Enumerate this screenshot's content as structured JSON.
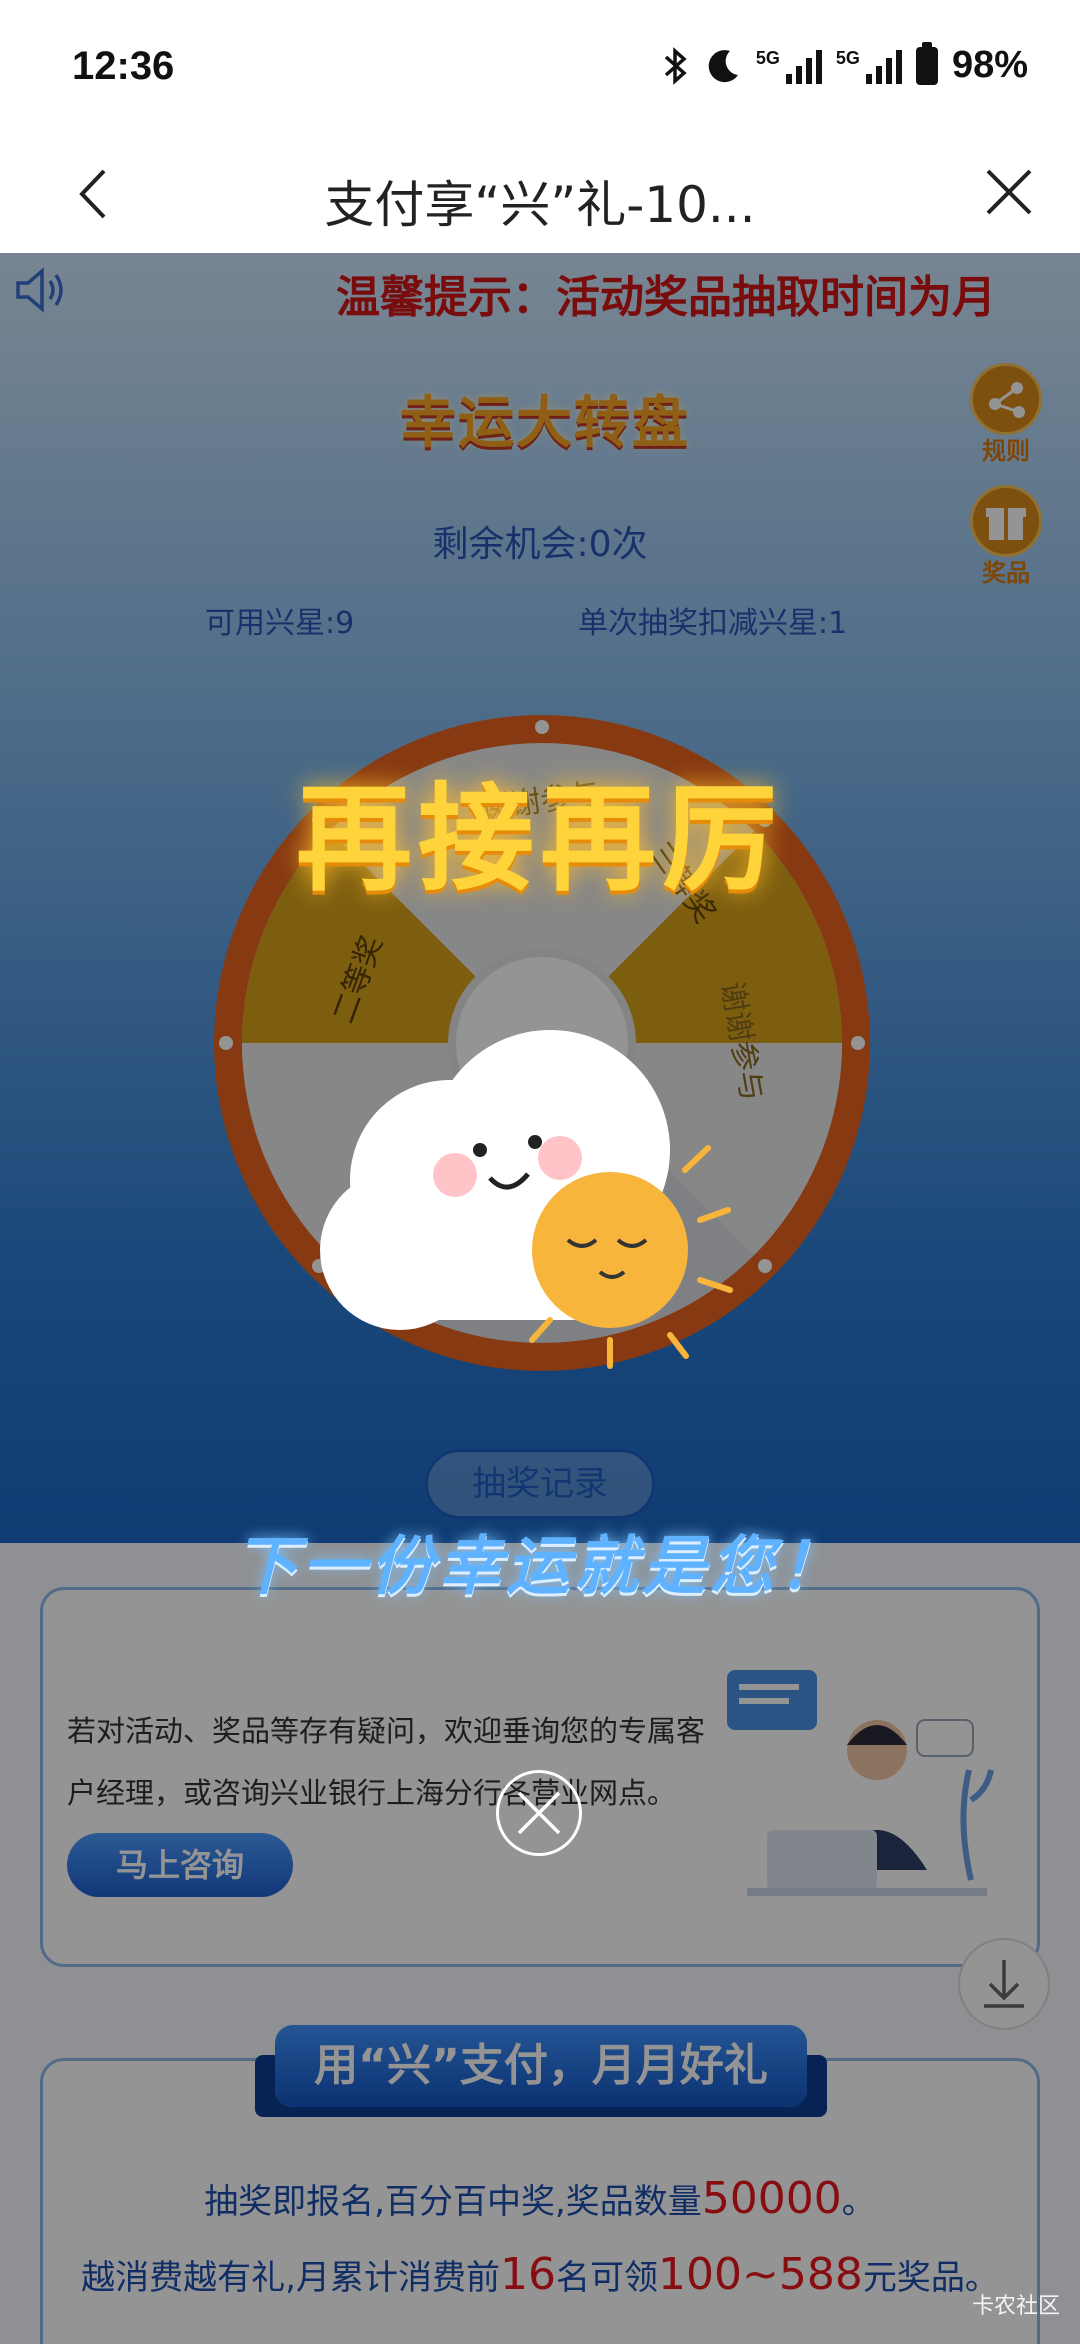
{
  "status_bar": {
    "time": "12:36",
    "battery": "98%",
    "net1": "5G",
    "net2": "5G"
  },
  "nav": {
    "title": "支付享“兴”礼-10..."
  },
  "notice": {
    "text": "温馨提示：活动奖品抽取时间为月"
  },
  "wheel_section": {
    "title": "幸运大转盘",
    "rules_label": "规则",
    "prizes_label": "奖品",
    "remaining": "剩余机会:0次",
    "stars": "可用兴星:9",
    "deduct": "单次抽奖扣减兴星:1",
    "segments": [
      "谢谢参与",
      "三等奖",
      "谢谢参与",
      "二等奖"
    ],
    "record_button": "抽奖记录"
  },
  "consult_card": {
    "text": "若对活动、奖品等存有疑问，欢迎垂询您的专属客户经理，或咨询兴业银行上海分行各营业网点。",
    "button": "马上咨询"
  },
  "promo_card": {
    "ribbon": "用“兴”支付，月月好礼",
    "line1_a": "抽奖即报名,百分百中奖,奖品数量",
    "line1_num": "50000",
    "line1_b": "。",
    "line2_a": "越消费越有礼,月累计消费前",
    "line2_num": "16",
    "line2_b": "名可领",
    "line2_range": "100~588",
    "line2_c": "元奖品。"
  },
  "popup": {
    "title": "再接再厉",
    "subtitle": "下一份幸运就是您！"
  },
  "watermark": "卡农社区",
  "colors": {
    "accent_blue": "#1d5fc4",
    "notice_red": "#d11818",
    "popup_gold": "#ffd43a"
  }
}
